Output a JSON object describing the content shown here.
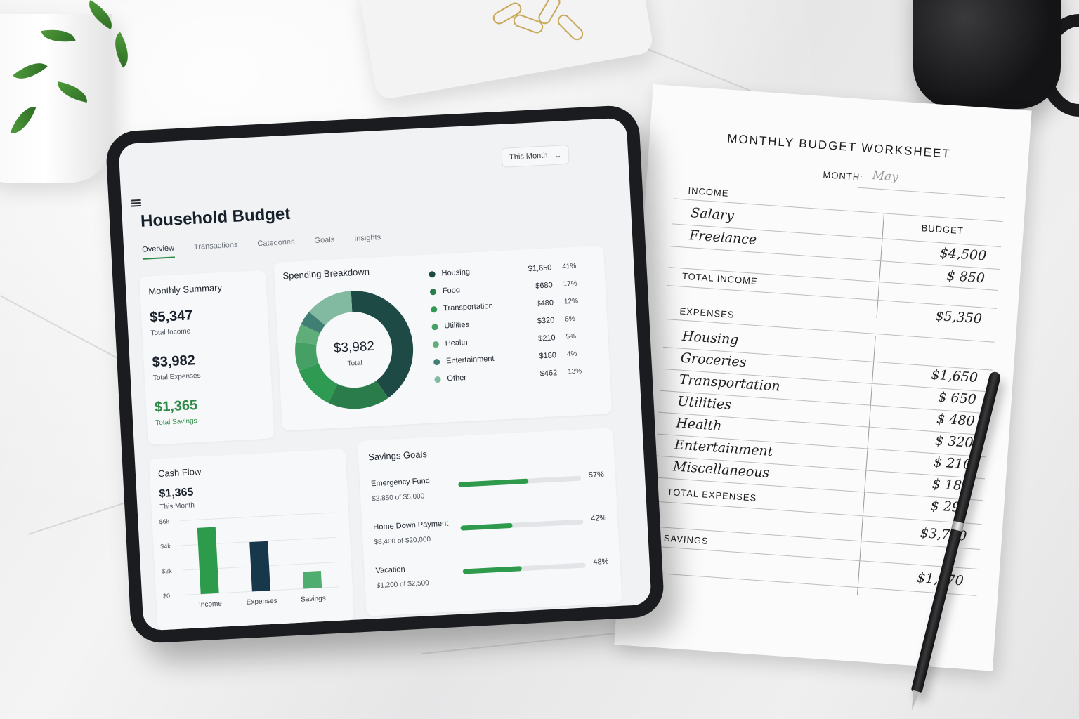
{
  "app": {
    "title": "Household Budget",
    "period_selector": "This Month",
    "tabs": [
      "Overview",
      "Transactions",
      "Categories",
      "Goals",
      "Insights"
    ],
    "active_tab": "Overview"
  },
  "monthly_summary": {
    "title": "Monthly Summary",
    "income_value": "$5,347",
    "income_label": "Total Income",
    "expenses_value": "$3,982",
    "expenses_label": "Total Expenses",
    "savings_value": "$1,365",
    "savings_label": "Total Savings"
  },
  "spending": {
    "title": "Spending Breakdown",
    "center_value": "$3,982",
    "center_label": "Total",
    "categories": [
      {
        "name": "Housing",
        "amount": "$1,650",
        "pct": "41%",
        "color": "#1d4a45"
      },
      {
        "name": "Food",
        "amount": "$680",
        "pct": "17%",
        "color": "#2a7d4b"
      },
      {
        "name": "Transportation",
        "amount": "$480",
        "pct": "12%",
        "color": "#2f9a52"
      },
      {
        "name": "Utilities",
        "amount": "$320",
        "pct": "8%",
        "color": "#46a066"
      },
      {
        "name": "Health",
        "amount": "$210",
        "pct": "5%",
        "color": "#5fae7a"
      },
      {
        "name": "Entertainment",
        "amount": "$180",
        "pct": "4%",
        "color": "#3f7f74"
      },
      {
        "name": "Other",
        "amount": "$462",
        "pct": "13%",
        "color": "#82b9a1"
      }
    ]
  },
  "cash_flow": {
    "title": "Cash Flow",
    "value": "$1,365",
    "caption": "This Month"
  },
  "chart_data": {
    "type": "bar",
    "categories": [
      "Income",
      "Expenses",
      "Savings"
    ],
    "values": [
      5347,
      3982,
      1365
    ],
    "y_ticks": [
      "$6k",
      "$4k",
      "$2k",
      "$0"
    ],
    "ylim": [
      0,
      6000
    ],
    "colors": [
      "#2e9a4c",
      "#16384a",
      "#4fae6f"
    ]
  },
  "savings_goals": {
    "title": "Savings Goals",
    "goals": [
      {
        "name": "Emergency Fund",
        "detail": "$2,850 of $5,000",
        "pct": "57%",
        "progress": 0.57
      },
      {
        "name": "Home Down Payment",
        "detail": "$8,400 of $20,000",
        "pct": "42%",
        "progress": 0.42
      },
      {
        "name": "Vacation",
        "detail": "$1,200 of $2,500",
        "pct": "48%",
        "progress": 0.48
      }
    ]
  },
  "worksheet": {
    "title": "MONTHLY BUDGET WORKSHEET",
    "month_label": "MONTH:",
    "month_value": "May",
    "income_heading": "INCOME",
    "budget_heading": "BUDGET",
    "income_items": [
      "Salary",
      "Freelance"
    ],
    "income_amounts": [
      "$4,500",
      "$ 850"
    ],
    "total_income_label": "TOTAL INCOME",
    "total_income_value": "$5,350",
    "expenses_heading": "EXPENSES",
    "expense_items": [
      "Housing",
      "Groceries",
      "Transportation",
      "Utilities",
      "Health",
      "Entertainment",
      "Miscellaneous"
    ],
    "expense_amounts": [
      "$1,650",
      "$ 650",
      "$ 480",
      "$ 320",
      "$ 210",
      "$ 180",
      "$ 290"
    ],
    "total_expenses_label": "TOTAL EXPENSES",
    "total_expenses_value": "$3,780",
    "savings_label": "SAVINGS",
    "savings_value": "$1,570"
  }
}
